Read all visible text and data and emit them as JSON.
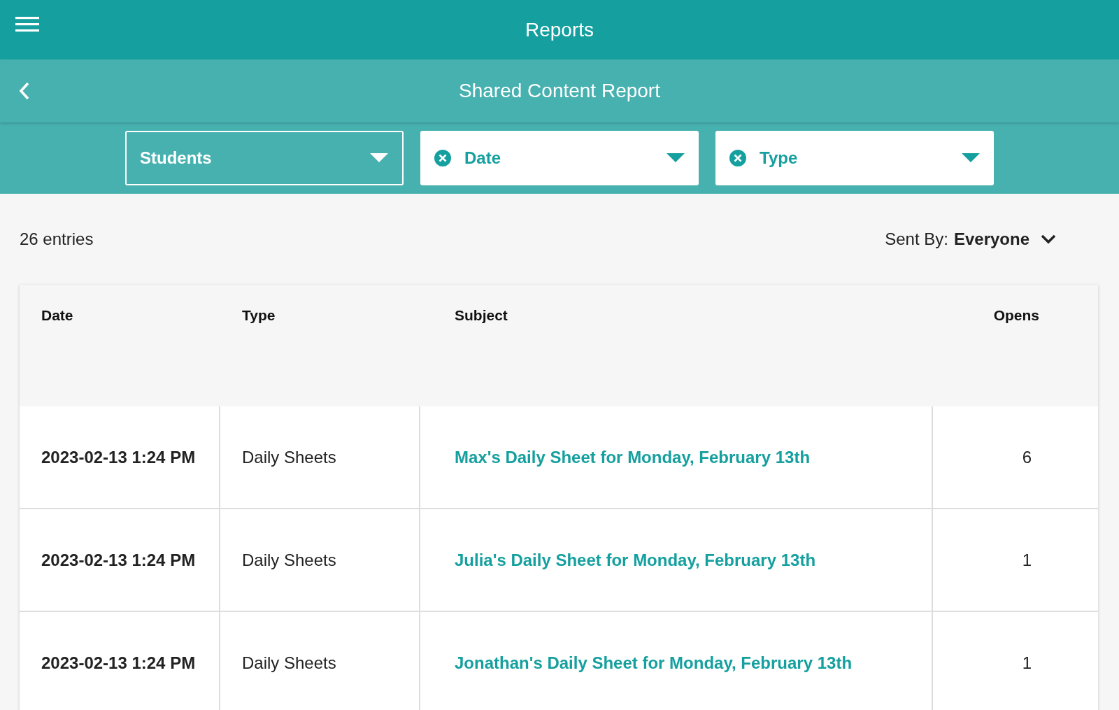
{
  "app_bar": {
    "title": "Reports"
  },
  "sub_bar": {
    "title": "Shared Content Report"
  },
  "filters": [
    {
      "kind": "outlined",
      "label": "Students"
    },
    {
      "kind": "filled",
      "label": "Date"
    },
    {
      "kind": "filled",
      "label": "Type"
    }
  ],
  "entries_count": "26 entries",
  "sent_by": {
    "label": "Sent By:",
    "value": "Everyone"
  },
  "table": {
    "columns": [
      "Date",
      "Type",
      "Subject",
      "Opens"
    ],
    "rows": [
      {
        "date": "2023-02-13 1:24 PM",
        "type": "Daily Sheets",
        "subject": "Max's Daily Sheet for Monday, February 13th",
        "opens": "6"
      },
      {
        "date": "2023-02-13 1:24 PM",
        "type": "Daily Sheets",
        "subject": "Julia's Daily Sheet for Monday, February 13th",
        "opens": "1"
      },
      {
        "date": "2023-02-13 1:24 PM",
        "type": "Daily Sheets",
        "subject": "Jonathan's Daily Sheet for Monday, February 13th",
        "opens": "1"
      }
    ]
  }
}
